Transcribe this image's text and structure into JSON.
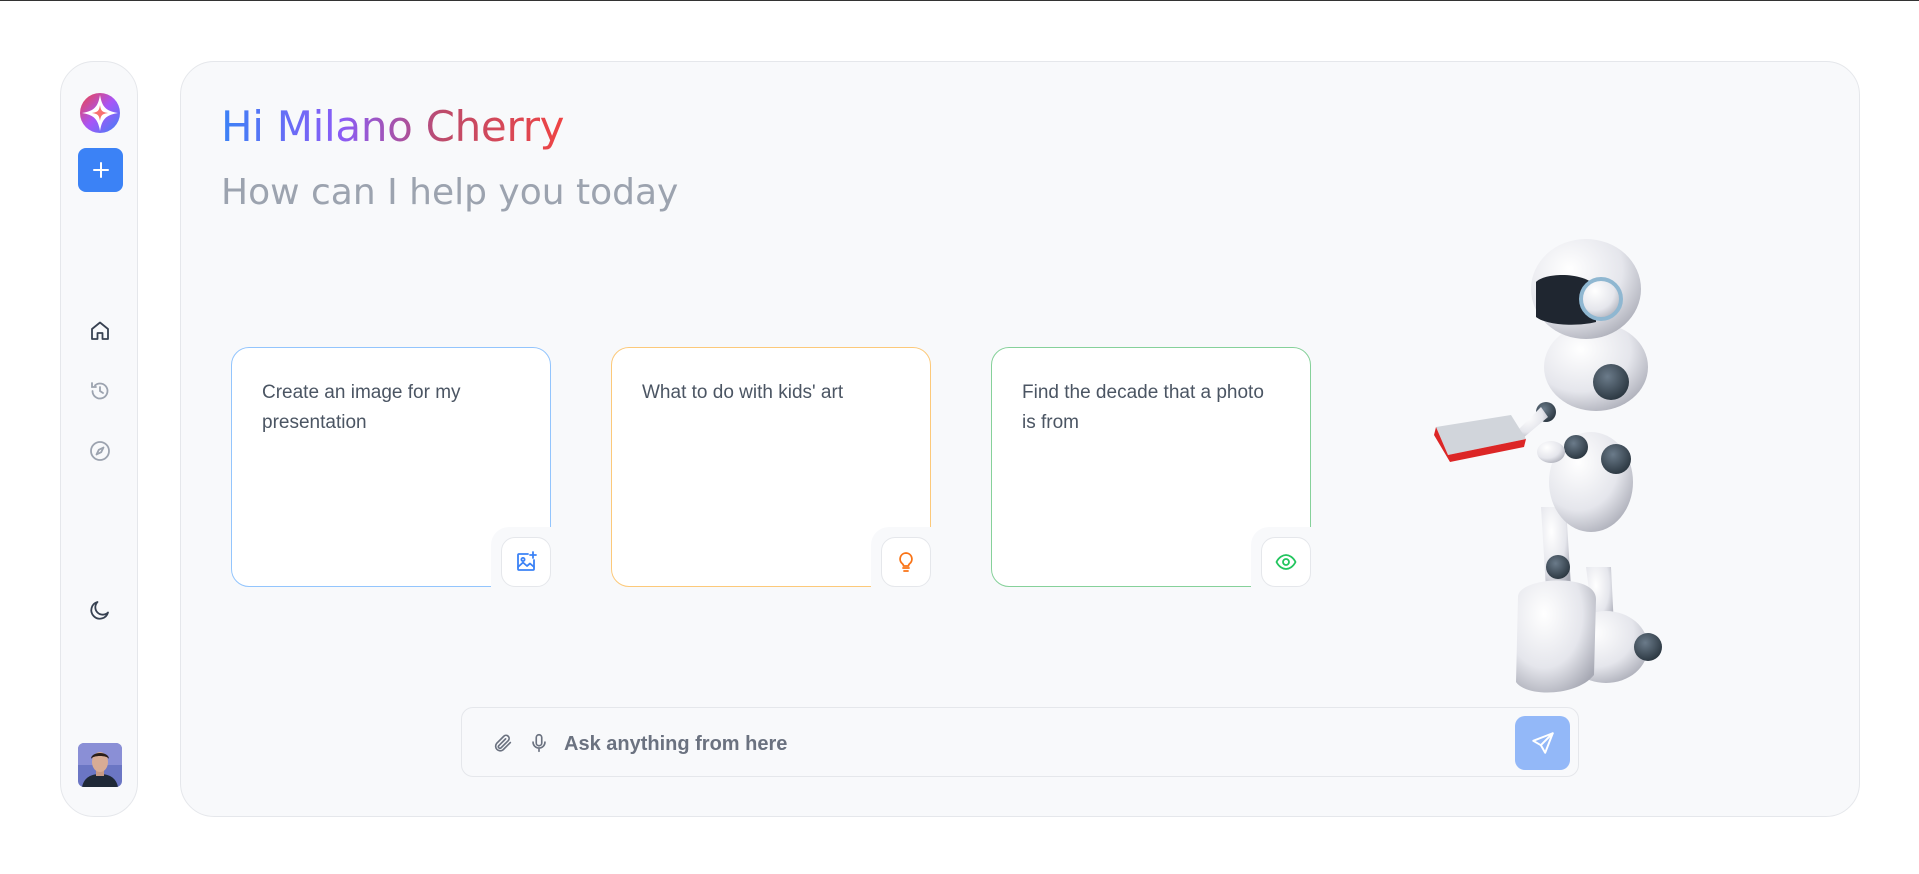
{
  "header": {
    "greeting": "Hi Milano Cherry",
    "subtitle": "How can I help you today"
  },
  "sidebar": {
    "items": [
      {
        "icon": "plus-icon",
        "label": "New chat"
      },
      {
        "icon": "home-icon"
      },
      {
        "icon": "history-icon"
      },
      {
        "icon": "compass-icon"
      },
      {
        "icon": "moon-icon"
      }
    ]
  },
  "cards": [
    {
      "text": "Create an image for my presentation",
      "icon": "image-plus-icon",
      "accent": "#60a5fa"
    },
    {
      "text": "What to do with kids' art",
      "icon": "lightbulb-icon",
      "accent": "#f59e0b"
    },
    {
      "text": "Find the decade that a photo is from",
      "icon": "eye-icon",
      "accent": "#22c55e"
    }
  ],
  "input": {
    "placeholder": "Ask anything from here",
    "value": ""
  },
  "colors": {
    "accent": "#3b82f6",
    "send_button": "#93b8f8",
    "panel_bg": "#f8f9fb"
  }
}
